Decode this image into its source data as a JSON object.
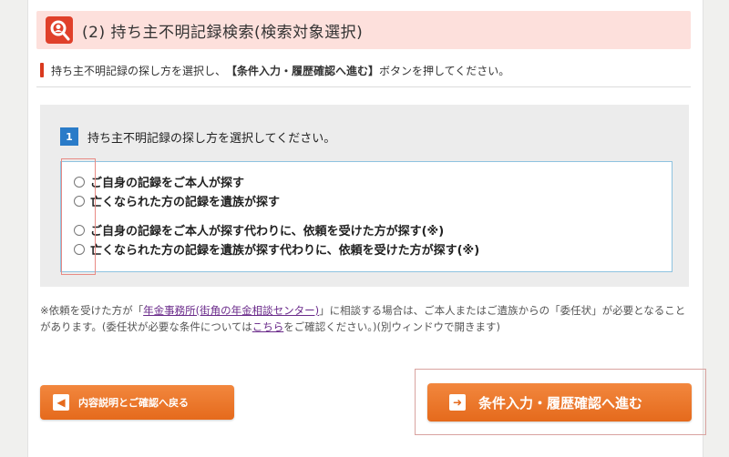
{
  "header": {
    "title": "(2) 持ち主不明記録検索(検索対象選択)",
    "icon": "search-person-icon",
    "accent_color": "#e0402a",
    "background_color": "#fde0dc"
  },
  "instruction": {
    "prefix": "持ち主不明記録の探し方を選択し、",
    "bold": "【条件入力・履歴確認へ進む】",
    "suffix": "ボタンを押してください。"
  },
  "step": {
    "number": "1",
    "label": "持ち主不明記録の探し方を選択してください。"
  },
  "options": [
    {
      "label": "ご自身の記録をご本人が探す",
      "checked": false
    },
    {
      "label": "亡くなられた方の記録を遺族が探す",
      "checked": false
    },
    {
      "label": "ご自身の記録をご本人が探す代わりに、依頼を受けた方が探す(※)",
      "checked": false
    },
    {
      "label": "亡くなられた方の記録を遺族が探す代わりに、依頼を受けた方が探す(※)",
      "checked": false
    }
  ],
  "note": {
    "part1": "※依頼を受けた方が「",
    "link1": "年金事務所(街角の年金相談センター)",
    "part2": "」に相談する場合は、ご本人またはご遺族からの「委任状」が必要となることがあります。(委任状が必要な条件については",
    "link2": "こちら",
    "part3": "をご確認ください。)(別ウィンドウで開きます)"
  },
  "buttons": {
    "back_label": "内容説明とご確認へ戻る",
    "back_icon": "arrow-left-icon",
    "next_label": "条件入力・履歴確認へ進む",
    "next_icon": "arrow-right-icon",
    "color": "#e8732a"
  }
}
